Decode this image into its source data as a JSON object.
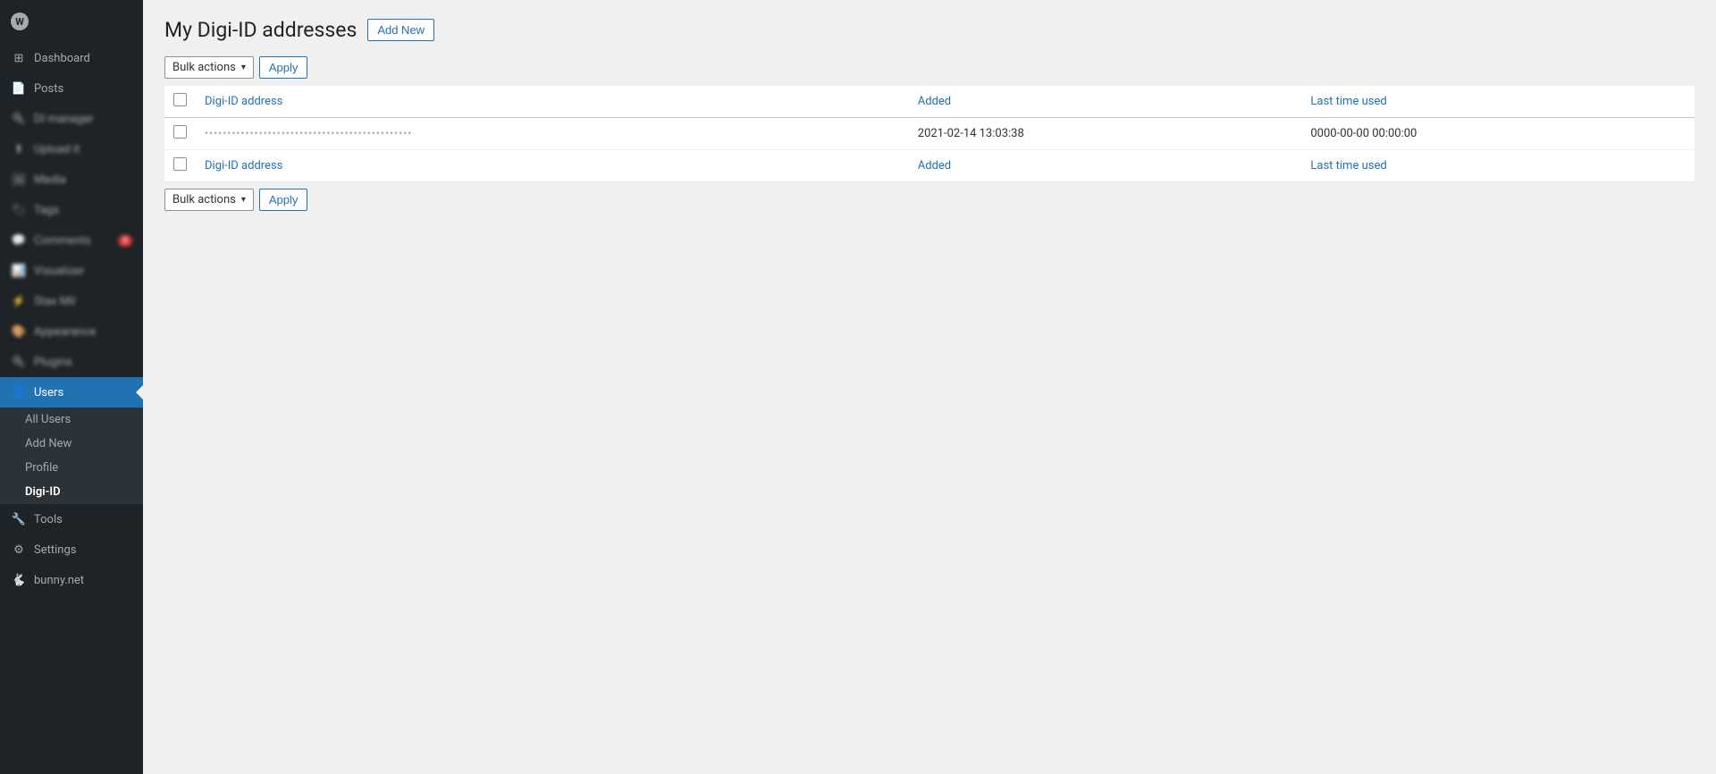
{
  "sidebar": {
    "logo_label": "W",
    "items": [
      {
        "id": "dashboard",
        "label": "Dashboard",
        "icon": "dashboard-icon",
        "active": false
      },
      {
        "id": "posts",
        "label": "Posts",
        "icon": "posts-icon",
        "active": false
      },
      {
        "id": "di-manager",
        "label": "DI manager",
        "icon": "di-icon",
        "active": false,
        "blurred": true
      },
      {
        "id": "upload",
        "label": "Upload it",
        "icon": "upload-icon",
        "active": false,
        "blurred": true
      },
      {
        "id": "media",
        "label": "Media",
        "icon": "media-icon",
        "active": false,
        "blurred": true
      },
      {
        "id": "tags",
        "label": "Tags",
        "icon": "tags-icon",
        "active": false,
        "blurred": true
      },
      {
        "id": "comments",
        "label": "Comments",
        "icon": "comments-icon",
        "active": false,
        "blurred": true,
        "badge": "8"
      },
      {
        "id": "visualizer",
        "label": "Visualizer",
        "icon": "visualizer-icon",
        "active": false,
        "blurred": true
      },
      {
        "id": "stax-mil",
        "label": "Stax Mil",
        "icon": "stax-icon",
        "active": false,
        "blurred": true
      },
      {
        "id": "appearance",
        "label": "Appearance",
        "icon": "appearance-icon",
        "active": false,
        "blurred": true
      },
      {
        "id": "plugins",
        "label": "Plugins",
        "icon": "plugins-icon",
        "active": false,
        "blurred": true
      },
      {
        "id": "users",
        "label": "Users",
        "icon": "users-icon",
        "active": true
      },
      {
        "id": "tools",
        "label": "Tools",
        "icon": "tools-icon",
        "active": false
      },
      {
        "id": "settings",
        "label": "Settings",
        "icon": "settings-icon",
        "active": false
      },
      {
        "id": "bunny-net",
        "label": "bunny.net",
        "icon": "bunny-icon",
        "active": false
      }
    ],
    "users_submenu": [
      {
        "id": "all-users",
        "label": "All Users",
        "active": false
      },
      {
        "id": "add-new",
        "label": "Add New",
        "active": false
      },
      {
        "id": "profile",
        "label": "Profile",
        "active": false
      },
      {
        "id": "digi-id",
        "label": "Digi-ID",
        "active": true
      }
    ]
  },
  "main": {
    "page_title": "My Digi-ID addresses",
    "add_new_label": "Add New",
    "bulk_actions_label": "Bulk actions",
    "apply_label_top": "Apply",
    "apply_label_bottom": "Apply",
    "table": {
      "col_address": "Digi-ID address",
      "col_added": "Added",
      "col_last_used": "Last time used",
      "rows": [
        {
          "address": "••••••••••••••••••••••••••••••••••••••••••",
          "added": "2021-02-14 13:03:38",
          "last_used": "0000-00-00 00:00:00"
        }
      ]
    }
  }
}
